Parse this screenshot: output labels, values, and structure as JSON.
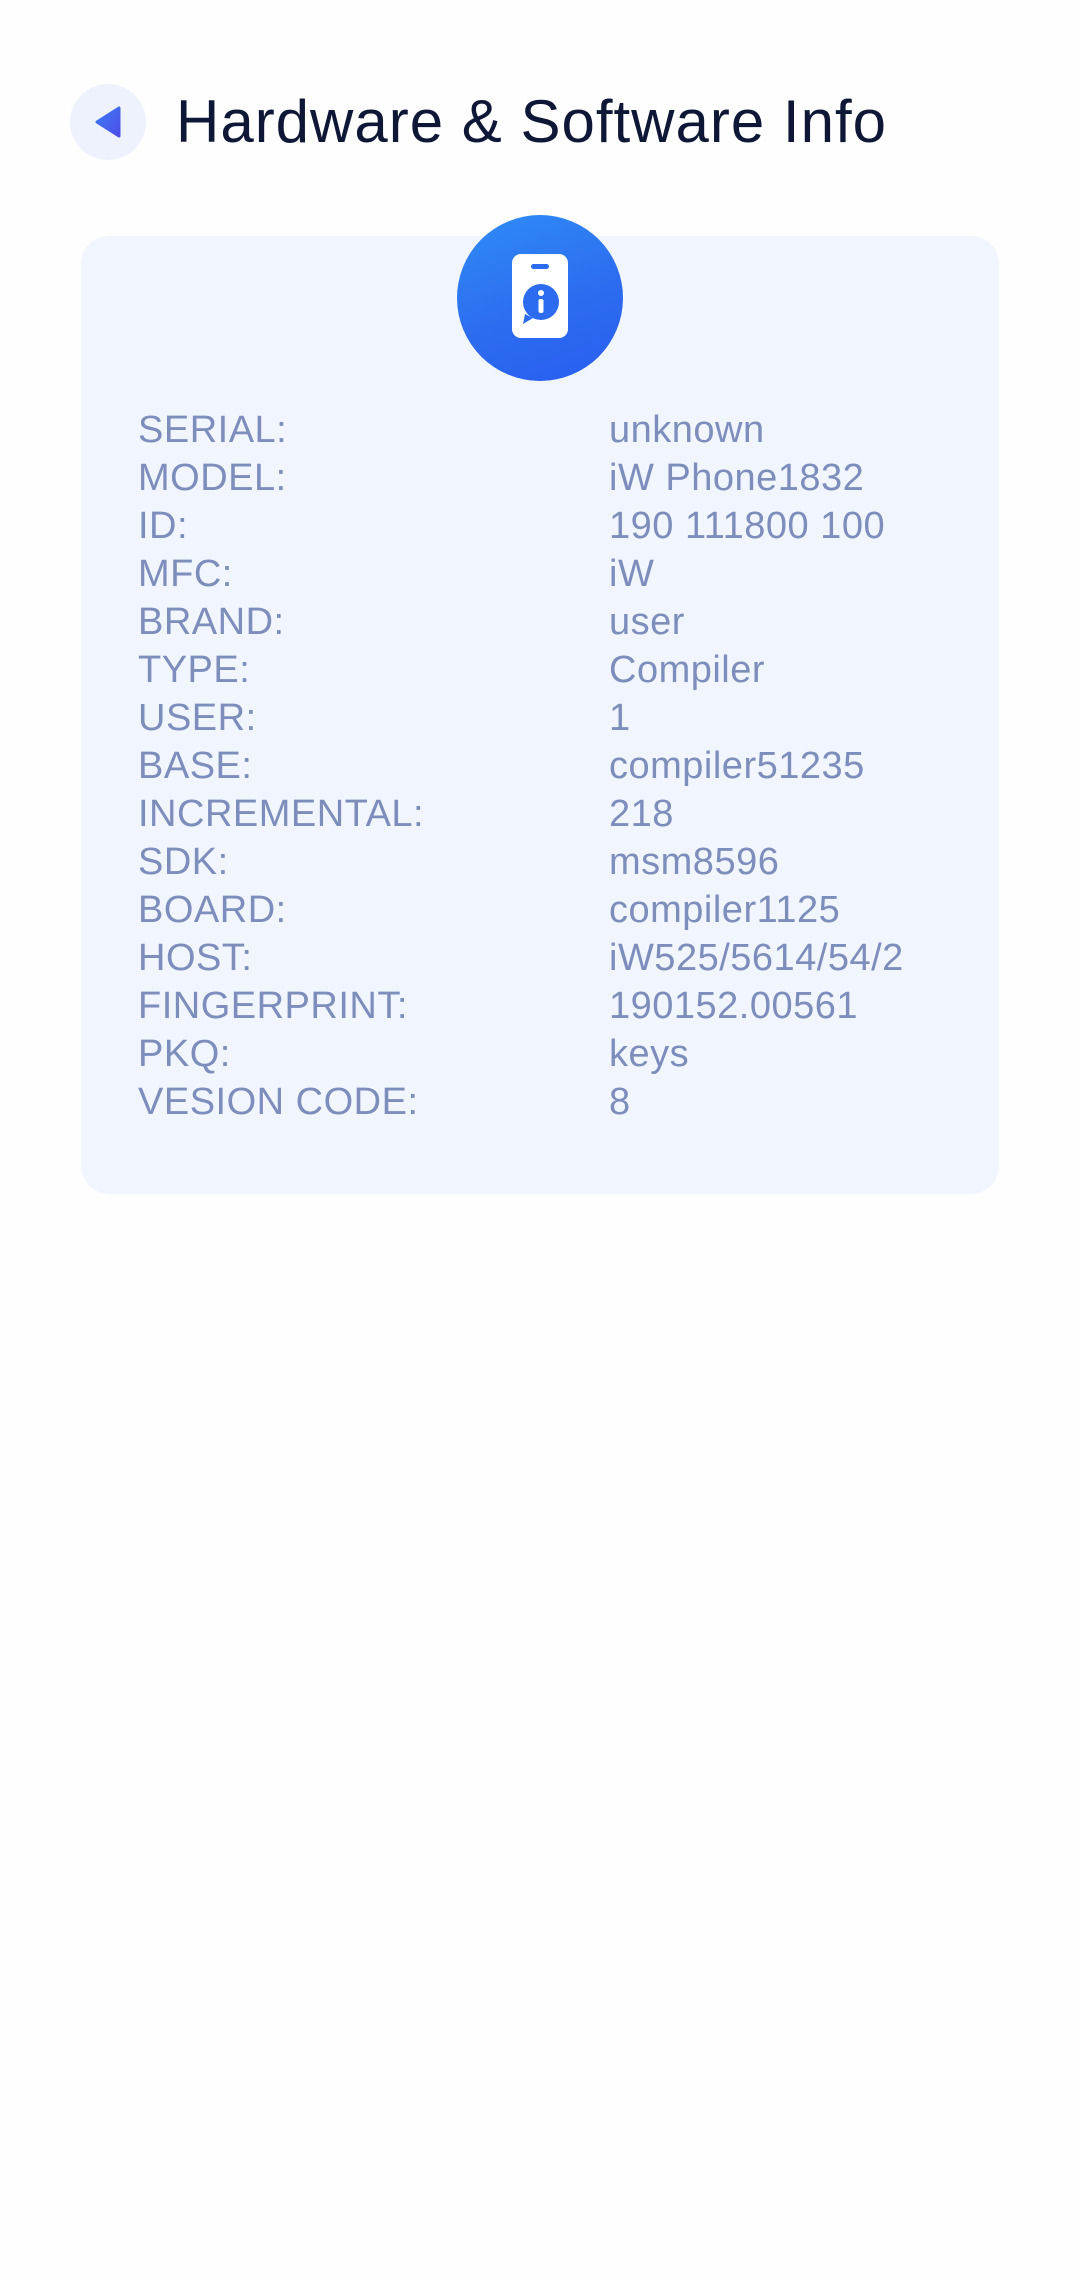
{
  "header": {
    "title": "Hardware & Software Info",
    "back_icon": "back-arrow-icon"
  },
  "card": {
    "badge_icon": "phone-info-icon",
    "rows": [
      {
        "label": "SERIAL:",
        "value": "unknown"
      },
      {
        "label": "MODEL:",
        "value": "iW Phone1832"
      },
      {
        "label": "ID:",
        "value": "190 111800 100"
      },
      {
        "label": "MFC:",
        "value": "iW"
      },
      {
        "label": "BRAND:",
        "value": "user"
      },
      {
        "label": "TYPE:",
        "value": "Compiler"
      },
      {
        "label": "USER:",
        "value": "1"
      },
      {
        "label": "BASE:",
        "value": "compiler51235"
      },
      {
        "label": "INCREMENTAL:",
        "value": "218"
      },
      {
        "label": "SDK:",
        "value": "msm8596"
      },
      {
        "label": "BOARD:",
        "value": "compiler1125"
      },
      {
        "label": "HOST:",
        "value": "iW525/5614/54/2"
      },
      {
        "label": "FINGERPRINT:",
        "value": "190152.00561"
      },
      {
        "label": "PKQ:",
        "value": "keys"
      },
      {
        "label": "VESION CODE:",
        "value": "8"
      }
    ]
  },
  "colors": {
    "accent": "#2d6cf0",
    "card_background": "#f1f5fd",
    "text_muted": "#7d8dbc",
    "title": "#0f1736"
  }
}
